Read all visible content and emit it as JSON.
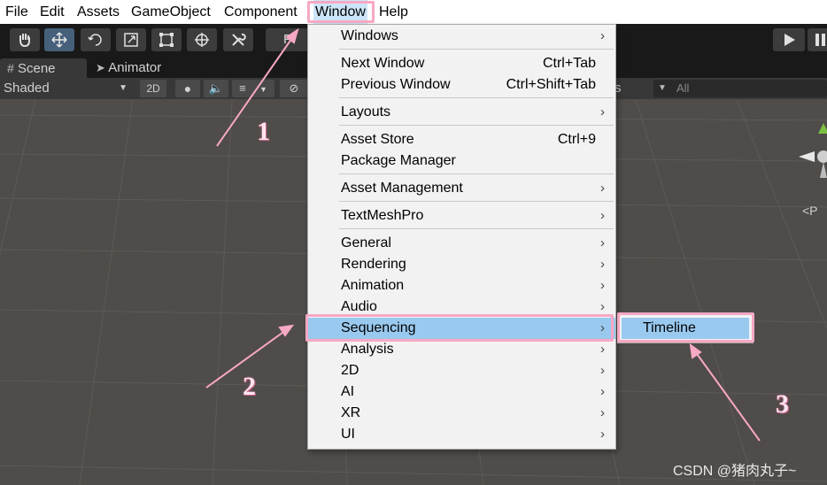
{
  "menubar": {
    "items": [
      "File",
      "Edit",
      "Assets",
      "GameObject",
      "Component",
      "Window",
      "Help"
    ]
  },
  "toolbar": {
    "pivot_label": "Pi"
  },
  "tabs": [
    {
      "label": "Scene",
      "icon": "grid-icon"
    },
    {
      "label": "Animator",
      "icon": "animator-icon"
    }
  ],
  "scene_toolbar": {
    "shading_mode": "Shaded",
    "mode_2d": "2D",
    "search_placeholder": "All",
    "gizmos_fragment": "s"
  },
  "window_menu": {
    "groups": [
      [
        {
          "label": "Windows",
          "submenu": true
        }
      ],
      [
        {
          "label": "Next Window",
          "shortcut": "Ctrl+Tab"
        },
        {
          "label": "Previous Window",
          "shortcut": "Ctrl+Shift+Tab"
        }
      ],
      [
        {
          "label": "Layouts",
          "submenu": true
        }
      ],
      [
        {
          "label": "Asset Store",
          "shortcut": "Ctrl+9"
        },
        {
          "label": "Package Manager"
        }
      ],
      [
        {
          "label": "Asset Management",
          "submenu": true
        }
      ],
      [
        {
          "label": "TextMeshPro",
          "submenu": true
        }
      ],
      [
        {
          "label": "General",
          "submenu": true
        },
        {
          "label": "Rendering",
          "submenu": true
        },
        {
          "label": "Animation",
          "submenu": true
        },
        {
          "label": "Audio",
          "submenu": true
        },
        {
          "label": "Sequencing",
          "submenu": true,
          "highlighted": true
        },
        {
          "label": "Analysis",
          "submenu": true
        },
        {
          "label": "2D",
          "submenu": true
        },
        {
          "label": "AI",
          "submenu": true
        },
        {
          "label": "XR",
          "submenu": true
        },
        {
          "label": "UI",
          "submenu": true
        }
      ]
    ]
  },
  "submenu": {
    "items": [
      "Timeline"
    ]
  },
  "annotations": {
    "step1": "1",
    "step2": "2",
    "step3": "3",
    "color": "#f7a8c4"
  },
  "gizmo": {
    "persp_label": "<P"
  },
  "watermark": "CSDN @猪肉丸子~"
}
